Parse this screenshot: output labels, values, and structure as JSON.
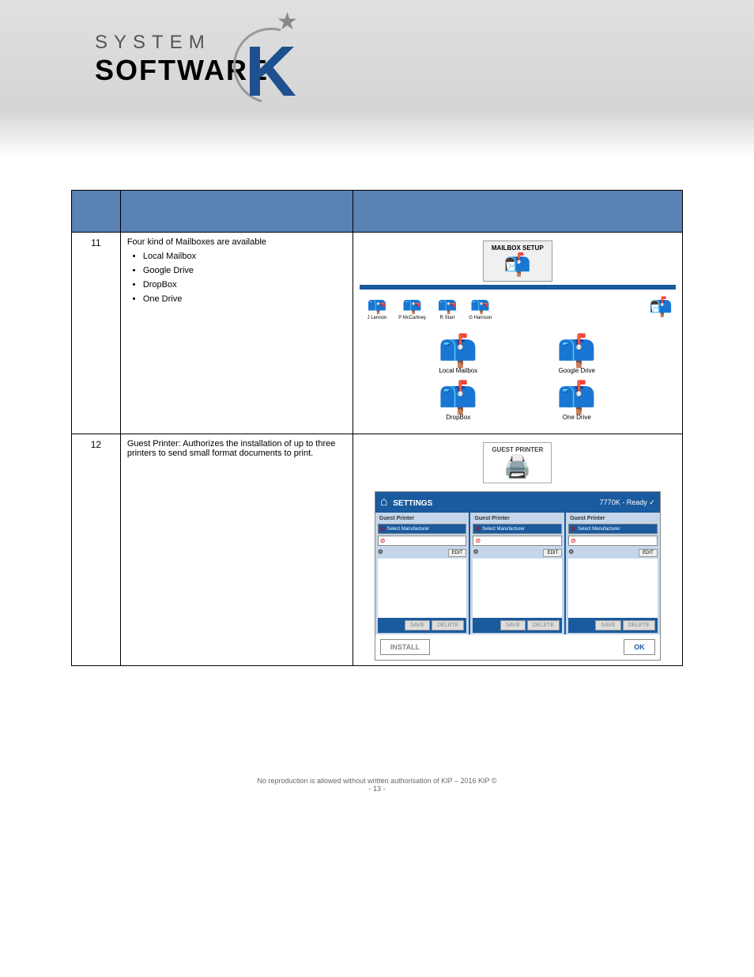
{
  "logo": {
    "line1": "SYSTEM",
    "line2": "SOFTWARE",
    "k": "K"
  },
  "table": {
    "row1": {
      "num": "11",
      "desc_intro": "Four kind of Mailboxes are available",
      "bullets": [
        "Local Mailbox",
        "Google Drive",
        "DropBox",
        "One Drive"
      ],
      "mailbox_setup_label": "MAILBOX SETUP",
      "small_mailboxes": [
        "J Lennon",
        "P McCartney",
        "R Starr",
        "G Harrison"
      ],
      "big_mailboxes": [
        "Local Mailbox",
        "Google Drive",
        "DropBox",
        "One Drive"
      ]
    },
    "row2": {
      "num": "12",
      "desc": "Guest Printer: Authorizes the installation of up to three printers to send small format documents to print.",
      "guest_printer_label": "GUEST PRINTER",
      "settings_title": "SETTINGS",
      "status": "7770K - Ready",
      "col_title": "Guest Printer",
      "select_mfr": "Select Manufacturer",
      "edit": "EDIT",
      "save": "SAVE",
      "delete": "DELETE",
      "install": "INSTALL",
      "ok": "OK"
    }
  },
  "footer": {
    "copyright": "No reproduction is allowed without written authorisation of KIP – 2016 KIP",
    "page": "- 13 -"
  }
}
